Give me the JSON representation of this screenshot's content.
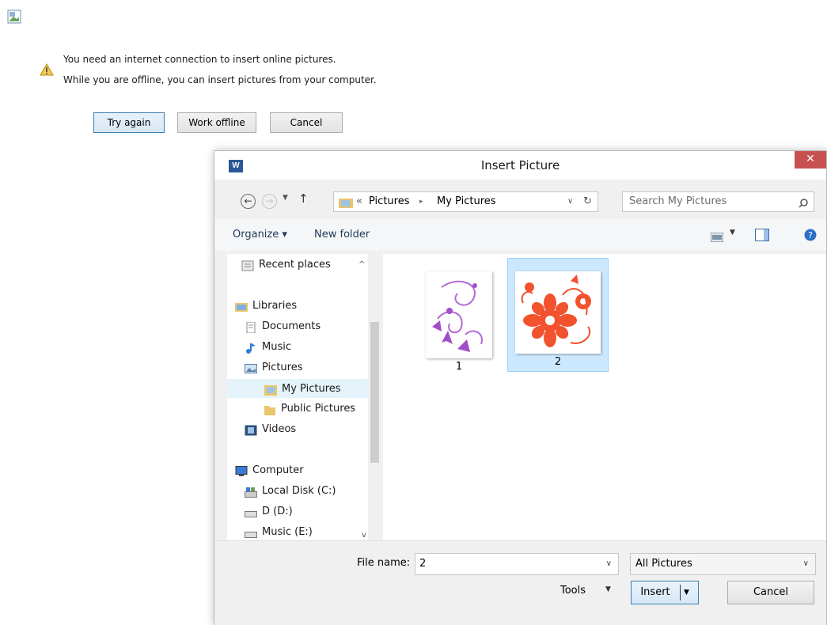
{
  "banner": {
    "line1": "You need an internet connection to insert online pictures.",
    "line2": "While you are offline, you can insert pictures from your computer.",
    "try_again": "Try again",
    "work_offline": "Work offline",
    "cancel": "Cancel"
  },
  "dialog": {
    "title": "Insert Picture",
    "close_glyph": "✕",
    "address": {
      "overflow": "«",
      "crumbs": [
        "Pictures",
        "My Pictures"
      ],
      "separator": "▸"
    },
    "search_placeholder": "Search My Pictures",
    "toolbar": {
      "organize": "Organize ▾",
      "new_folder": "New folder"
    },
    "nav_items": [
      {
        "label": "Recent places",
        "icon": "recent-places-icon"
      },
      {
        "label": "Libraries",
        "icon": "libraries-icon"
      },
      {
        "label": "Documents",
        "icon": "documents-icon"
      },
      {
        "label": "Music",
        "icon": "music-icon"
      },
      {
        "label": "Pictures",
        "icon": "pictures-icon"
      },
      {
        "label": "My Pictures",
        "icon": "folder-icon",
        "selected": true
      },
      {
        "label": "Public Pictures",
        "icon": "folder-icon"
      },
      {
        "label": "Videos",
        "icon": "videos-icon"
      },
      {
        "label": "Computer",
        "icon": "computer-icon"
      },
      {
        "label": "Local Disk (C:)",
        "icon": "disk-icon"
      },
      {
        "label": "D (D:)",
        "icon": "drive-icon"
      },
      {
        "label": "Music (E:)",
        "icon": "drive-icon"
      }
    ],
    "files": [
      {
        "name": "1",
        "selected": false
      },
      {
        "name": "2",
        "selected": true
      }
    ],
    "file_name_label": "File name:",
    "file_name_value": "2",
    "filter_value": "All Pictures",
    "tools": "Tools",
    "insert": "Insert",
    "cancel": "Cancel"
  },
  "colors": {
    "accent": "#3c7fb1",
    "close": "#c75050",
    "selection": "#cce8ff"
  }
}
